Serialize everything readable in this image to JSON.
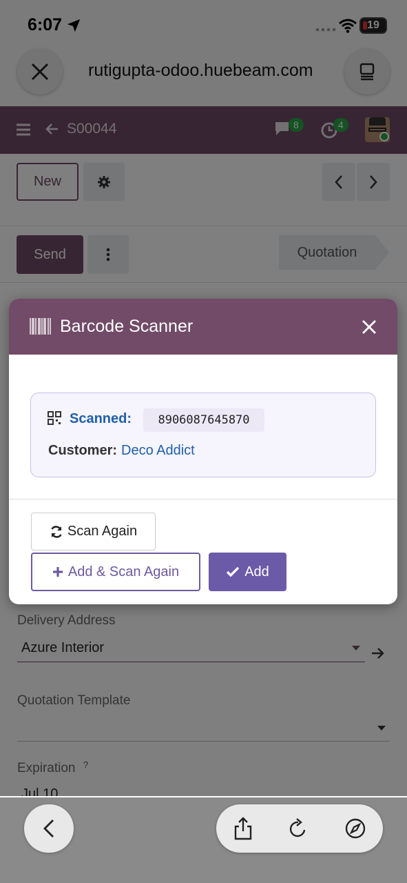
{
  "status_bar": {
    "time": "6:07",
    "battery": "19"
  },
  "browser": {
    "url": "rutigupta-odoo.huebeam.com"
  },
  "navbar": {
    "breadcrumb": "S00044",
    "messages_count": "8",
    "activities_count": "4"
  },
  "control_panel": {
    "new_label": "New"
  },
  "status": {
    "send_label": "Send",
    "stage_label": "Quotation"
  },
  "form": {
    "delivery_label": "Delivery Address",
    "delivery_value": "Azure Interior",
    "template_label": "Quotation Template",
    "expiration_label": "Expiration",
    "expiration_help": "?",
    "expiration_value": "Jul 10"
  },
  "modal": {
    "title": "Barcode Scanner",
    "scanned_label": "Scanned:",
    "scanned_code": "8906087645870",
    "customer_label": "Customer:",
    "customer_value": "Deco Addict",
    "scan_again_label": "Scan Again",
    "add_scan_again_label": "Add & Scan Again",
    "add_label": "Add"
  },
  "colors": {
    "brand": "#714b67",
    "link": "#1f5fa8",
    "accent": "#6b5aa8",
    "badge": "#28a745"
  },
  "icons": [
    "location-arrow-icon",
    "wifi-icon",
    "battery-icon",
    "close-icon",
    "tabs-icon",
    "hamburger-icon",
    "back-arrow-icon",
    "chat-icon",
    "clock-icon",
    "avatar",
    "gear-icon",
    "chevron-left-icon",
    "chevron-right-icon",
    "kebab-icon",
    "barcode-icon",
    "qr-icon",
    "refresh-icon",
    "plus-icon",
    "check-icon",
    "share-icon",
    "reload-icon",
    "compass-icon"
  ]
}
